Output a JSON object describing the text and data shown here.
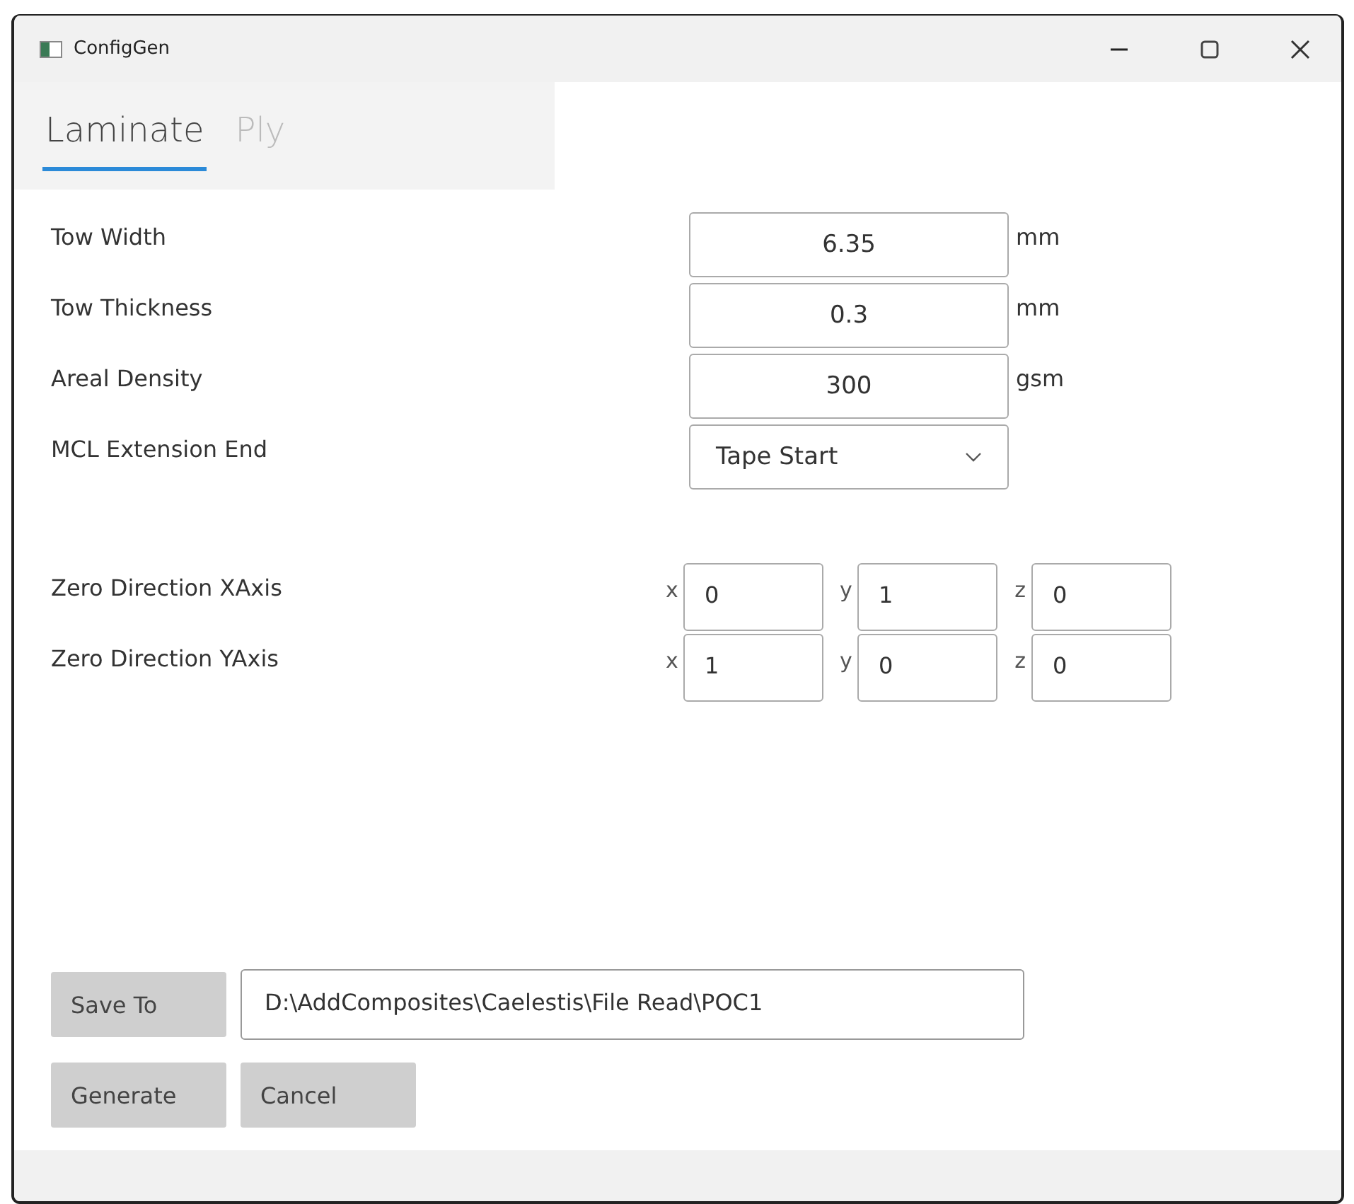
{
  "window": {
    "title": "ConfigGen"
  },
  "tabs": [
    {
      "label": "Laminate",
      "selected": true
    },
    {
      "label": "Ply",
      "selected": false
    }
  ],
  "fields": [
    {
      "kind": "text",
      "label": "Tow Width",
      "value": "6.35",
      "unit": "mm"
    },
    {
      "kind": "text",
      "label": "Tow Thickness",
      "value": "0.3",
      "unit": "mm"
    },
    {
      "kind": "text",
      "label": "Areal Density",
      "value": "300",
      "unit": "gsm"
    },
    {
      "kind": "dropdown",
      "label": "MCL Extension End",
      "value": "Tape Start"
    }
  ],
  "vectors": [
    {
      "label": "Zero Direction XAxis",
      "components": [
        {
          "axis": "x",
          "value": "0"
        },
        {
          "axis": "y",
          "value": "1"
        },
        {
          "axis": "z",
          "value": "0"
        }
      ]
    },
    {
      "label": "Zero Direction YAxis",
      "components": [
        {
          "axis": "x",
          "value": "1"
        },
        {
          "axis": "y",
          "value": "0"
        },
        {
          "axis": "z",
          "value": "0"
        }
      ]
    }
  ],
  "save_to": {
    "button": "Save To",
    "path": "D:\\AddComposites\\Caelestis\\File Read\\POC1"
  },
  "buttons": [
    "Generate",
    "Cancel"
  ]
}
